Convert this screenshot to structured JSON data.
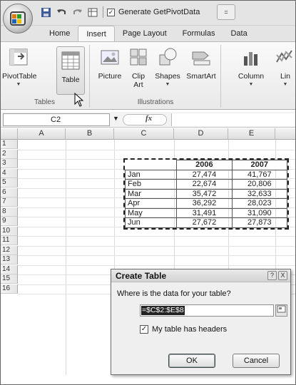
{
  "quick_access": {
    "checkbox_label": "Generate GetPivotData",
    "office_logo_text": "ⓍI"
  },
  "tabs": [
    "Home",
    "Insert",
    "Page Layout",
    "Formulas",
    "Data"
  ],
  "active_tab": "Insert",
  "ribbon": {
    "tables_group": {
      "label": "Tables",
      "buttons": [
        {
          "label": "PivotTable",
          "icon": "pivot-table-icon",
          "has_dropdown": true
        },
        {
          "label": "Table",
          "icon": "table-icon",
          "has_dropdown": false
        }
      ]
    },
    "illustrations_group": {
      "label": "Illustrations",
      "buttons": [
        {
          "label": "Picture",
          "icon": "picture-icon",
          "has_dropdown": false
        },
        {
          "label": "Clip Art",
          "line1": "Clip",
          "line2": "Art",
          "icon": "clip-art-icon",
          "has_dropdown": false
        },
        {
          "label": "Shapes",
          "icon": "shapes-icon",
          "has_dropdown": true
        },
        {
          "label": "SmartArt",
          "icon": "smartart-icon",
          "has_dropdown": false
        }
      ]
    },
    "charts_group": {
      "buttons": [
        {
          "label": "Column",
          "icon": "column-chart-icon",
          "has_dropdown": true
        },
        {
          "label": "Lin",
          "icon": "line-chart-icon",
          "has_dropdown": true
        }
      ]
    }
  },
  "formula_bar": {
    "name_box": "C2",
    "fx_label": "fx",
    "formula": ""
  },
  "columns": [
    "A",
    "B",
    "C",
    "D",
    "E"
  ],
  "rows": [
    "1",
    "2",
    "3",
    "4",
    "5",
    "6",
    "7",
    "8",
    "9",
    "10",
    "11",
    "12",
    "13",
    "14",
    "15",
    "16"
  ],
  "table": {
    "headers": [
      "",
      "2006",
      "2007"
    ],
    "rows": [
      [
        "Jan",
        "27,474",
        "41,767"
      ],
      [
        "Feb",
        "22,674",
        "20,806"
      ],
      [
        "Mar",
        "35,472",
        "32,633"
      ],
      [
        "Apr",
        "36,292",
        "28,023"
      ],
      [
        "May",
        "31,491",
        "31,090"
      ],
      [
        "Jun",
        "27,672",
        "27,873"
      ]
    ]
  },
  "dialog": {
    "title": "Create Table",
    "help_button": "?",
    "close_button": "X",
    "prompt": "Where is the data for your table?",
    "range_value": "=$C$2:$E$8",
    "headers_checkbox_label": "My table has headers",
    "headers_checked": true,
    "ok_label": "OK",
    "cancel_label": "Cancel"
  },
  "colors": {
    "ribbon_bg": "#eeeeee",
    "selection_highlight": "#222222",
    "dialog_bg": "#efefef"
  }
}
